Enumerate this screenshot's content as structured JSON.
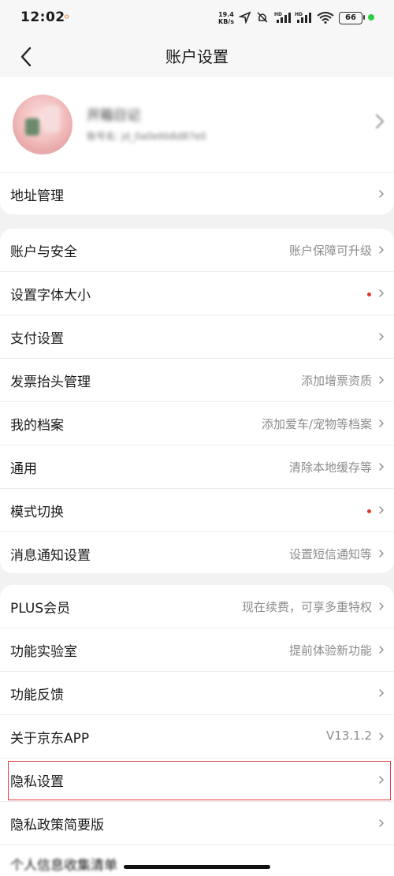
{
  "status_bar": {
    "time": "12:02",
    "speed_value": "19.4",
    "speed_unit": "KB/s",
    "battery": "66",
    "network_labels": [
      "HD",
      "HD"
    ]
  },
  "header": {
    "title": "账户设置"
  },
  "profile": {
    "nickname": "开箱日记",
    "account_id": "账号名: jd_0a0e6b8d87e0"
  },
  "address": {
    "label": "地址管理"
  },
  "settings_group": [
    {
      "label": "账户与安全",
      "value": "账户保障可升级",
      "dot": false
    },
    {
      "label": "设置字体大小",
      "value": "",
      "dot": true
    },
    {
      "label": "支付设置",
      "value": "",
      "dot": false
    },
    {
      "label": "发票抬头管理",
      "value": "添加增票资质",
      "dot": false
    },
    {
      "label": "我的档案",
      "value": "添加爱车/宠物等档案",
      "dot": false
    },
    {
      "label": "通用",
      "value": "清除本地缓存等",
      "dot": false
    },
    {
      "label": "模式切换",
      "value": "",
      "dot": true
    },
    {
      "label": "消息通知设置",
      "value": "设置短信通知等",
      "dot": false
    }
  ],
  "more_group": [
    {
      "label": "PLUS会员",
      "value": "现在续费，可享多重特权"
    },
    {
      "label": "功能实验室",
      "value": "提前体验新功能"
    },
    {
      "label": "功能反馈",
      "value": ""
    },
    {
      "label": "关于京东APP",
      "value": "V13.1.2"
    },
    {
      "label": "隐私设置",
      "value": ""
    },
    {
      "label": "隐私政策简要版",
      "value": ""
    }
  ],
  "cut_off_row": "个人信息收集清单",
  "colors": {
    "accent_red": "#e6352b",
    "background": "#f2f2f2",
    "highlight": "#e33a3a"
  }
}
